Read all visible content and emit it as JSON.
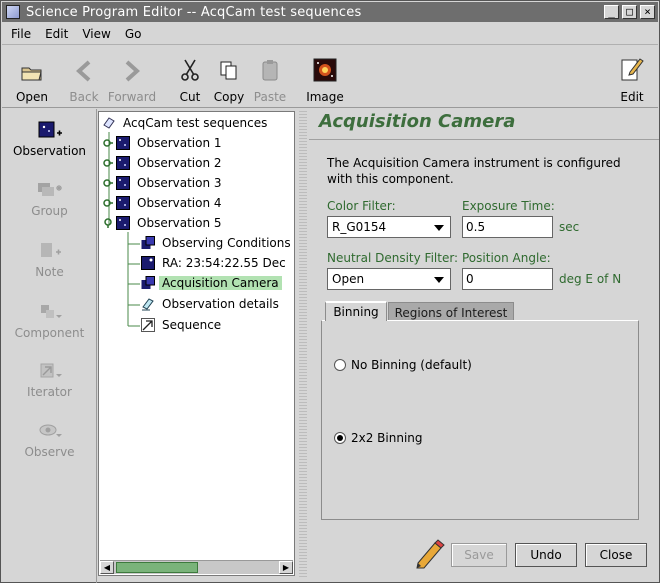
{
  "window": {
    "title": "Science Program Editor -- AcqCam test sequences",
    "buttons": [
      "minimize",
      "maximize",
      "close"
    ]
  },
  "menu": [
    "File",
    "Edit",
    "View",
    "Go"
  ],
  "toolbar": {
    "open": "Open",
    "back": "Back",
    "forward": "Forward",
    "cut": "Cut",
    "copy": "Copy",
    "paste": "Paste",
    "image": "Image",
    "edit": "Edit"
  },
  "palette": {
    "observation": "Observation",
    "group": "Group",
    "note": "Note",
    "component": "Component",
    "iterator": "Iterator",
    "observe": "Observe"
  },
  "tree": {
    "root": "AcqCam test sequences",
    "observations": [
      "Observation 1",
      "Observation 2",
      "Observation 3",
      "Observation 4",
      "Observation 5"
    ],
    "children": [
      "Observing Conditions",
      "RA: 23:54:22.55 Dec",
      "Acquisition Camera",
      "Observation details",
      "Sequence"
    ],
    "selected": "Acquisition Camera"
  },
  "editor": {
    "title": "Acquisition Camera",
    "description": "The Acquisition Camera instrument is configured with this component.",
    "color_filter_label": "Color Filter:",
    "color_filter_value": "R_G0154",
    "exposure_label": "Exposure Time:",
    "exposure_value": "0.5",
    "exposure_unit": "sec",
    "nd_filter_label": "Neutral Density Filter:",
    "nd_filter_value": "Open",
    "pos_angle_label": "Position Angle:",
    "pos_angle_value": "0",
    "pos_angle_unit": "deg E of N",
    "tabs": [
      "Binning",
      "Regions of Interest"
    ],
    "binning_options": [
      "No  Binning (default)",
      "2x2 Binning"
    ],
    "binning_selected": "2x2 Binning"
  },
  "buttons": {
    "save": "Save",
    "undo": "Undo",
    "close": "Close"
  },
  "colors": {
    "accent_green": "#3d6e3d",
    "selection": "#b2e2b2",
    "titlebar": "#6e6e6e"
  }
}
